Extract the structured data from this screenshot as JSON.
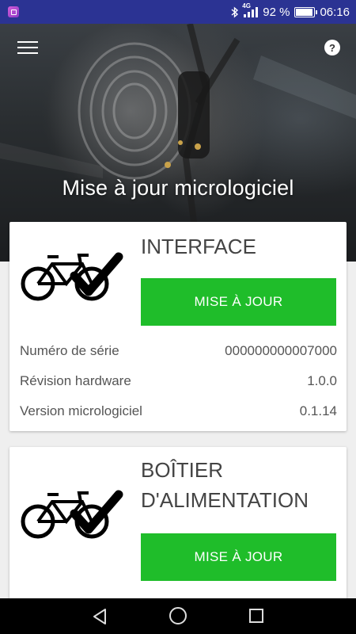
{
  "status_bar": {
    "network": "4G",
    "battery": "92 %",
    "battery_level": 0.92,
    "time": "06:16",
    "icons": [
      "gallery-icon",
      "bluetooth-icon",
      "signal-icon",
      "battery-icon"
    ]
  },
  "header": {
    "title": "Mise à jour micrologiciel",
    "menu_icon": "hamburger-menu-icon",
    "help_icon": "help-icon",
    "help_glyph": "?"
  },
  "cards": [
    {
      "title": "INTERFACE",
      "icon": "bike-check-icon",
      "button_label": "MISE À JOUR",
      "rows": [
        {
          "label": "Numéro de série",
          "value": "000000000007000"
        },
        {
          "label": "Révision hardware",
          "value": "1.0.0"
        },
        {
          "label": "Version micrologiciel",
          "value": "0.1.14"
        }
      ]
    },
    {
      "title_line1": "BOÎTIER",
      "title_line2": "D'ALIMENTATION",
      "icon": "bike-check-icon",
      "button_label": "MISE À JOUR"
    }
  ],
  "nav_bar": {
    "icons": [
      "back-icon",
      "home-icon",
      "recent-apps-icon"
    ]
  },
  "colors": {
    "status_bar": "#2b3393",
    "accent_button": "#1fbd2a",
    "card_background": "#ffffff",
    "page_background": "#efefef"
  }
}
